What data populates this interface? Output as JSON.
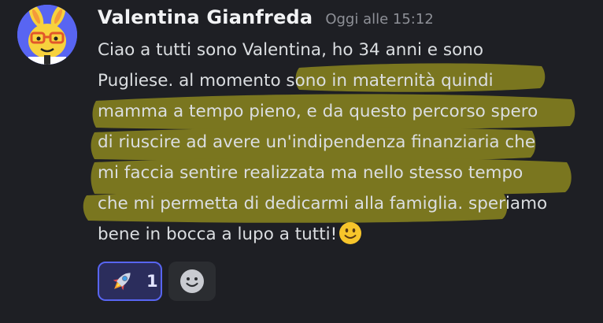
{
  "message": {
    "author": "Valentina Gianfreda",
    "timestamp": "Oggi alle 15:12",
    "lines": [
      "Ciao a tutti sono Valentina, ho 34 anni e sono",
      "Pugliese. al momento sono in maternità quindi",
      "mamma a tempo pieno, e da questo percorso spero",
      "di riuscire ad avere un'indipendenza finanziaria che",
      "mi faccia sentire realizzata ma nello stesso tempo",
      "che mi permetta di dedicarmi alla famiglia. speriamo",
      "bene in bocca a lupo a tutti!"
    ],
    "trailing_emoji": "slightly-smiling-face",
    "highlight_color": "#8f8a1e"
  },
  "reactions": [
    {
      "emoji": "rocket",
      "count": "1",
      "active": true
    }
  ],
  "colors": {
    "background": "#1e1f24",
    "accent": "#5865f2"
  }
}
